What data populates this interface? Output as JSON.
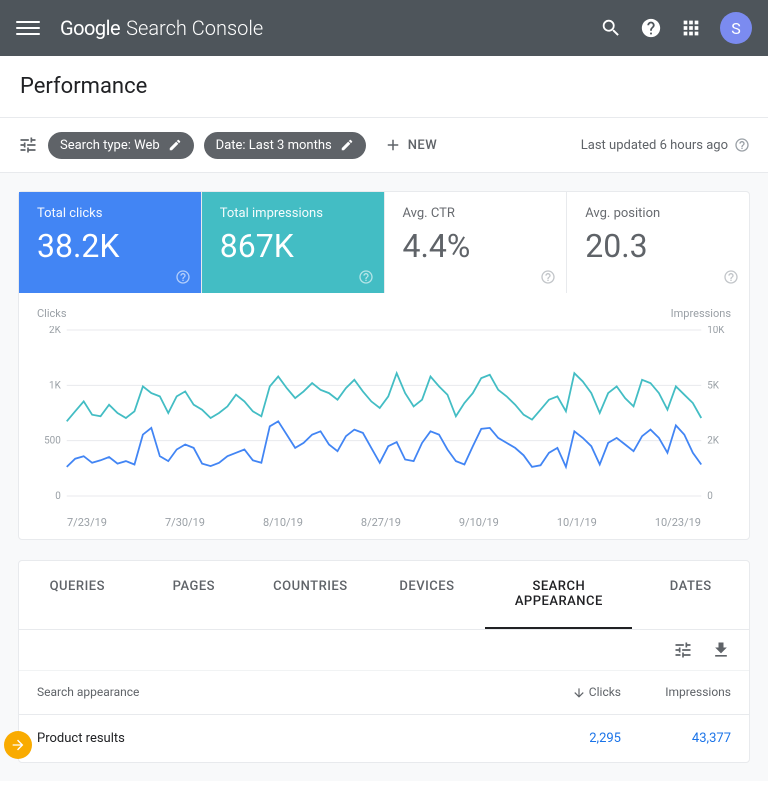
{
  "header": {
    "logo_google": "Google",
    "logo_product": "Search Console",
    "avatar_letter": "S"
  },
  "page": {
    "title": "Performance"
  },
  "filters": {
    "search_type": "Search type: Web",
    "date_range": "Date: Last 3 months",
    "new_label": "NEW",
    "last_updated": "Last updated 6 hours ago"
  },
  "metrics": [
    {
      "label": "Total clicks",
      "value": "38.2K",
      "active": "blue"
    },
    {
      "label": "Total impressions",
      "value": "867K",
      "active": "teal"
    },
    {
      "label": "Avg. CTR",
      "value": "4.4%",
      "active": false
    },
    {
      "label": "Avg. position",
      "value": "20.3",
      "active": false
    }
  ],
  "chart_data": {
    "type": "line",
    "left_axis_label": "Clicks",
    "right_axis_label": "Impressions",
    "left_ticks": [
      "2K",
      "1K",
      "500",
      "0"
    ],
    "right_ticks": [
      "10K",
      "5K",
      "2K",
      "0"
    ],
    "x_labels": [
      "7/23/19",
      "7/30/19",
      "8/10/19",
      "8/27/19",
      "9/10/19",
      "10/1/19",
      "10/23/19"
    ],
    "left_ylim": [
      0,
      2000
    ],
    "right_ylim": [
      0,
      10000
    ],
    "series": [
      {
        "name": "Clicks",
        "axis": "left",
        "values": [
          350,
          450,
          480,
          400,
          430,
          470,
          390,
          420,
          380,
          740,
          820,
          480,
          420,
          560,
          620,
          580,
          390,
          360,
          400,
          480,
          520,
          560,
          430,
          400,
          840,
          900,
          740,
          580,
          640,
          740,
          780,
          620,
          540,
          720,
          800,
          760,
          580,
          400,
          600,
          650,
          440,
          420,
          640,
          780,
          740,
          560,
          420,
          380,
          600,
          810,
          820,
          700,
          640,
          580,
          490,
          350,
          370,
          520,
          580,
          350,
          780,
          700,
          600,
          380,
          640,
          700,
          620,
          540,
          720,
          800,
          700,
          520,
          850,
          740,
          520,
          380
        ]
      },
      {
        "name": "Impressions",
        "axis": "right",
        "values": [
          4500,
          5100,
          5700,
          4900,
          4800,
          5500,
          5000,
          4700,
          5100,
          6600,
          6200,
          6000,
          5000,
          6000,
          6300,
          5500,
          5200,
          4700,
          5000,
          5400,
          6100,
          5700,
          5100,
          4800,
          6600,
          7200,
          6500,
          5900,
          6300,
          6800,
          6400,
          6200,
          5800,
          6500,
          7000,
          6300,
          5700,
          5300,
          6000,
          7400,
          6200,
          5400,
          5800,
          7200,
          6600,
          6100,
          4800,
          5600,
          6200,
          7100,
          7300,
          6400,
          6000,
          5500,
          4900,
          4600,
          5200,
          5800,
          6000,
          5100,
          7400,
          6900,
          6200,
          5000,
          6200,
          6600,
          5900,
          5400,
          7000,
          6800,
          6200,
          5200,
          6600,
          6100,
          5600,
          4700
        ]
      }
    ]
  },
  "tabs": [
    "QUERIES",
    "PAGES",
    "COUNTRIES",
    "DEVICES",
    "SEARCH APPEARANCE",
    "DATES"
  ],
  "active_tab": 4,
  "table": {
    "columns": [
      "Search appearance",
      "Clicks",
      "Impressions"
    ],
    "sort_column": 1,
    "rows": [
      {
        "name": "Product results",
        "clicks": "2,295",
        "impressions": "43,377"
      }
    ]
  }
}
